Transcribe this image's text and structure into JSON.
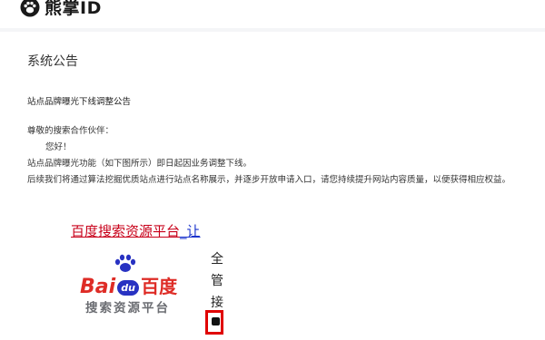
{
  "header": {
    "logo_text": "熊掌ID"
  },
  "page": {
    "title": "系统公告"
  },
  "notice": {
    "title": "站点品牌曝光下线调整公告",
    "greeting": "尊敬的搜索合作伙伴：",
    "hello": "您好！",
    "line1": "站点品牌曝光功能（如下图所示）即日起因业务调整下线。",
    "line2": "后续我们将通过算法挖掘优质站点进行站点名称展示，并逐步开放申请入口，请您持续提升网站内容质量，以便获得相应权益。"
  },
  "figure": {
    "head_red": "百度搜索资源平台",
    "head_link": "_让",
    "logo_bai": "Bai",
    "logo_du": "du",
    "logo_cn": "百度",
    "logo_sub": "搜索资源平台",
    "side_char_1": "全",
    "side_char_2": "管",
    "side_char_3": "接"
  },
  "colors": {
    "baidu_red": "#de2c26",
    "baidu_blue": "#2832c2",
    "link_blue": "#1a33cc",
    "highlight_red": "#e00000"
  }
}
